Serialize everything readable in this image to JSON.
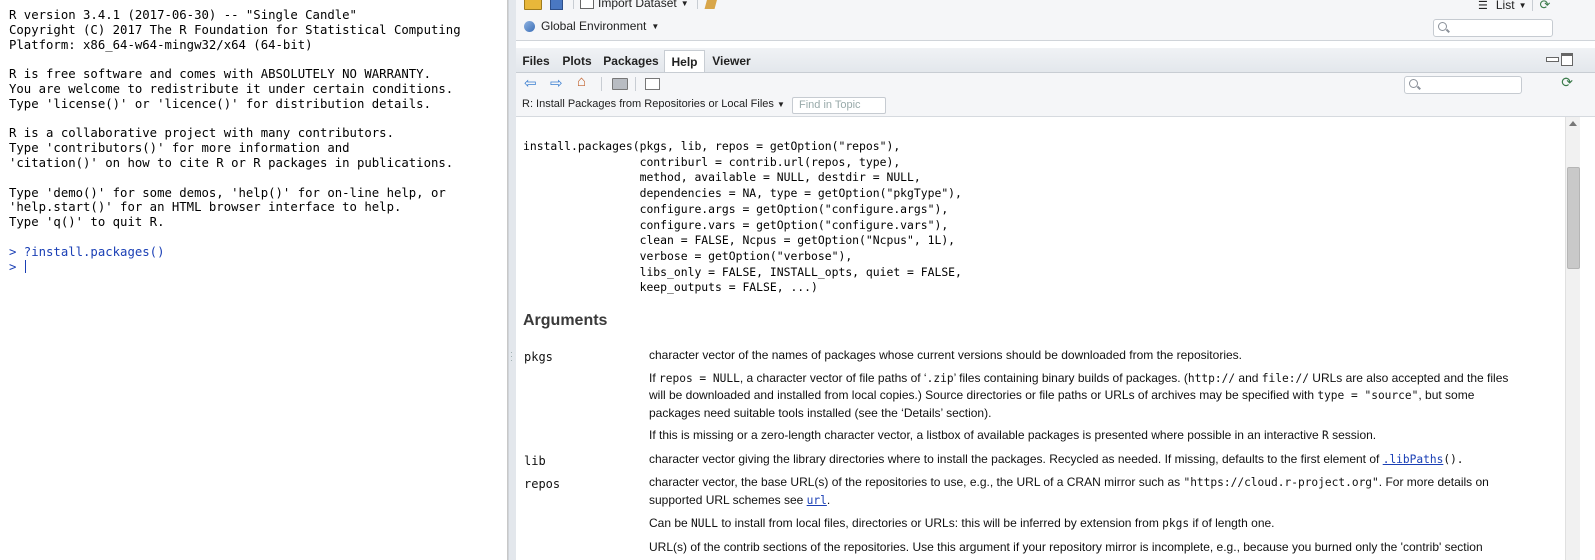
{
  "console": {
    "lines": [
      "R version 3.4.1 (2017-06-30) -- \"Single Candle\"",
      "Copyright (C) 2017 The R Foundation for Statistical Computing",
      "Platform: x86_64-w64-mingw32/x64 (64-bit)",
      "",
      "R is free software and comes with ABSOLUTELY NO WARRANTY.",
      "You are welcome to redistribute it under certain conditions.",
      "Type 'license()' or 'licence()' for distribution details.",
      "",
      "R is a collaborative project with many contributors.",
      "Type 'contributors()' for more information and",
      "'citation()' on how to cite R or R packages in publications.",
      "",
      "Type 'demo()' for some demos, 'help()' for on-line help, or",
      "'help.start()' for an HTML browser interface to help.",
      "Type 'q()' to quit R.",
      ""
    ],
    "command": "> ?install.packages()",
    "prompt": "> "
  },
  "env_pane": {
    "import_dataset": "Import Dataset",
    "view_mode": "List",
    "environment": "Global Environment"
  },
  "help_pane": {
    "tabs": [
      "Files",
      "Plots",
      "Packages",
      "Help",
      "Viewer"
    ],
    "active_tab": "Help",
    "topic": "R: Install Packages from Repositories or Local Files",
    "find_placeholder": "Find in Topic",
    "usage": "install.packages(pkgs, lib, repos = getOption(\"repos\"),\n                 contriburl = contrib.url(repos, type),\n                 method, available = NULL, destdir = NULL,\n                 dependencies = NA, type = getOption(\"pkgType\"),\n                 configure.args = getOption(\"configure.args\"),\n                 configure.vars = getOption(\"configure.vars\"),\n                 clean = FALSE, Ncpus = getOption(\"Ncpus\", 1L),\n                 verbose = getOption(\"verbose\"),\n                 libs_only = FALSE, INSTALL_opts, quiet = FALSE,\n                 keep_outputs = FALSE, ...)",
    "arguments_heading": "Arguments",
    "args": {
      "pkgs_name": "pkgs",
      "pkgs_p1": "character vector of the names of packages whose current versions should be downloaded from the repositories.",
      "pkgs_p2_a": "If ",
      "pkgs_p2_code1": "repos = NULL",
      "pkgs_p2_b": ", a character vector of file paths of ‘",
      "pkgs_p2_code2": ".zip",
      "pkgs_p2_c": "’ files containing binary builds of packages. (",
      "pkgs_p2_code3": "http://",
      "pkgs_p2_d": " and ",
      "pkgs_p2_code4": "file://",
      "pkgs_p2_e": " URLs are also accepted and the files will be downloaded and installed from local copies.) Source directories or file paths or URLs of archives may be specified with ",
      "pkgs_p2_code5": "type = \"source\"",
      "pkgs_p2_f": ", but some packages need suitable tools installed (see the ‘Details’ section).",
      "pkgs_p3_a": "If this is missing or a zero-length character vector, a listbox of available packages is presented where possible in an interactive ",
      "pkgs_p3_code": "R",
      "pkgs_p3_b": " session.",
      "lib_name": "lib",
      "lib_p1_a": "character vector giving the library directories where to install the packages. Recycled as needed. If missing, defaults to the first element of ",
      "lib_link": ".libPaths",
      "lib_p1_b": "().",
      "repos_name": "repos",
      "repos_p1_a": "character vector, the base URL(s) of the repositories to use, e.g., the URL of a CRAN mirror such as ",
      "repos_p1_code": "\"https://cloud.r-project.org\"",
      "repos_p1_b": ". For more details on supported URL schemes see ",
      "repos_link": "url",
      "repos_p1_c": ".",
      "repos_p2_a": "Can be ",
      "repos_p2_code1": "NULL",
      "repos_p2_b": " to install from local files, directories or URLs: this will be inferred by extension from ",
      "repos_p2_code2": "pkgs",
      "repos_p2_c": " if of length one.",
      "trailing": "URL(s) of the contrib sections of the repositories. Use this argument if your repository mirror is incomplete, e.g., because you burned only the 'contrib' section"
    }
  }
}
